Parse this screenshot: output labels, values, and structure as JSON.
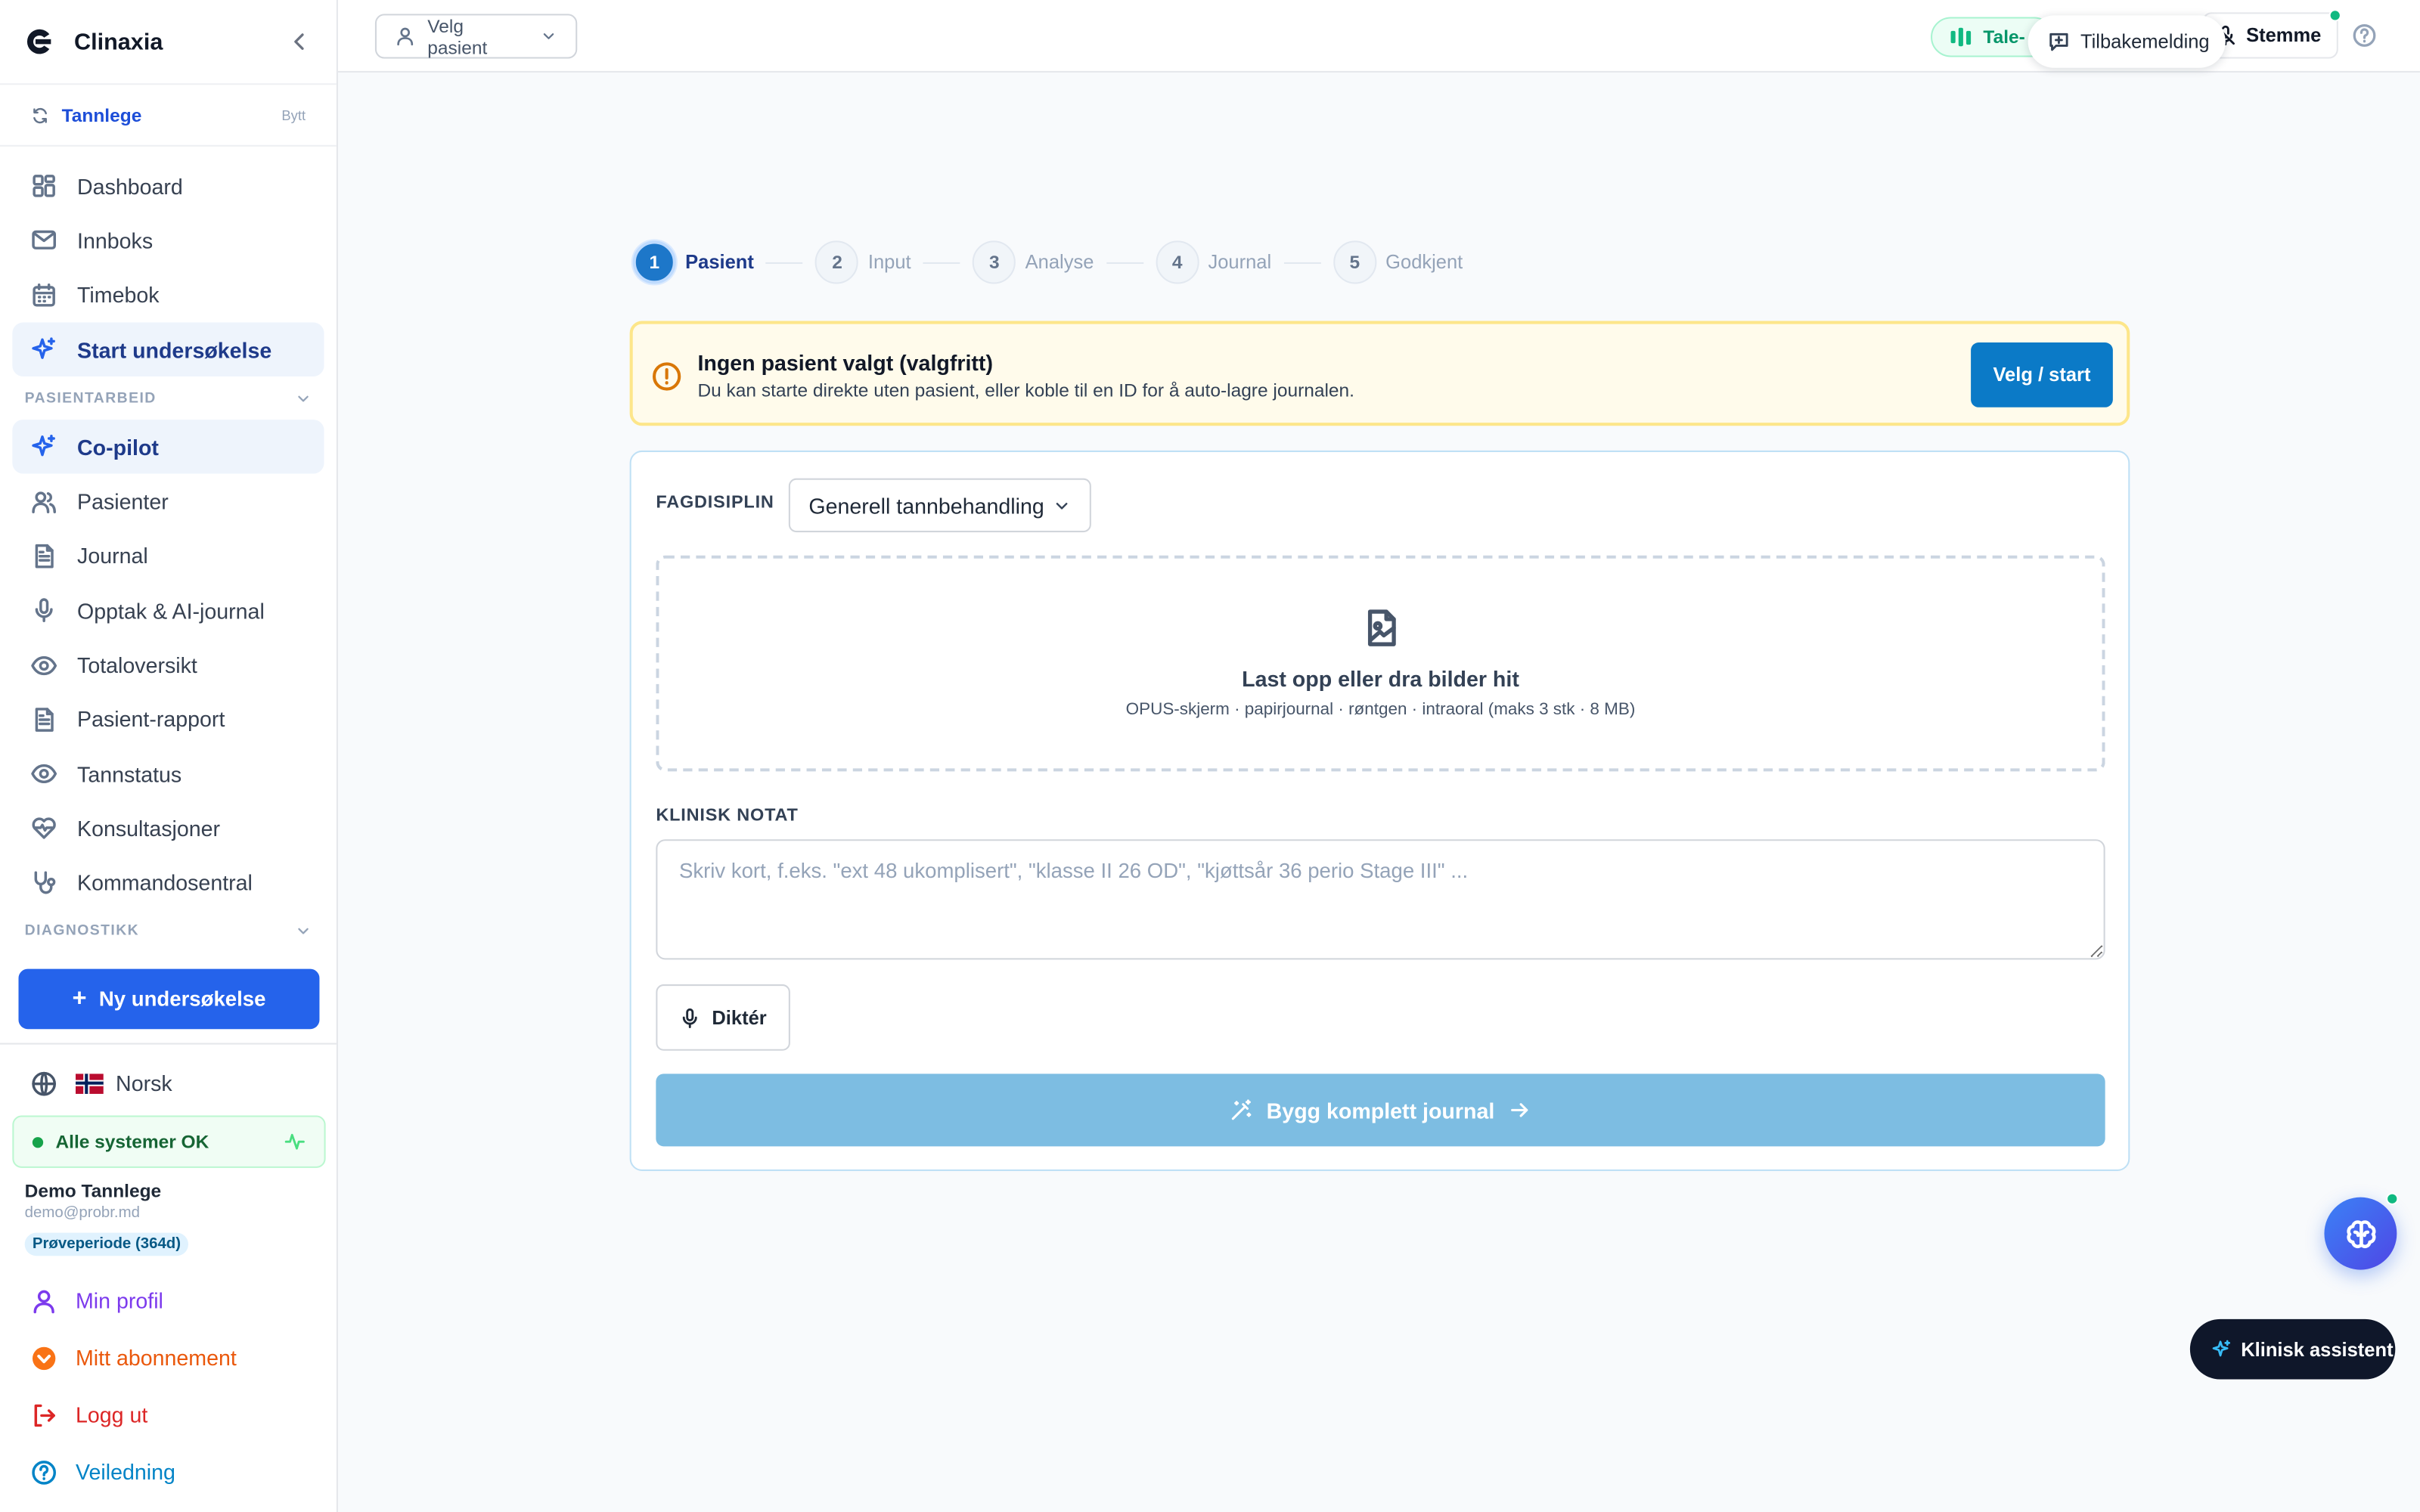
{
  "app": {
    "name": "Clinaxia"
  },
  "role": {
    "label": "Tannlege",
    "switch_label": "Bytt"
  },
  "nav": {
    "primary": [
      {
        "label": "Dashboard",
        "icon": "dashboard-icon"
      },
      {
        "label": "Innboks",
        "icon": "mail-icon"
      },
      {
        "label": "Timebok",
        "icon": "calendar-icon"
      },
      {
        "label": "Start undersøkelse",
        "icon": "sparkle-icon",
        "active": true
      }
    ],
    "section_patient": "PASIENTARBEID",
    "patient": [
      {
        "label": "Co-pilot",
        "icon": "sparkle-icon",
        "active": true
      },
      {
        "label": "Pasienter",
        "icon": "users-icon"
      },
      {
        "label": "Journal",
        "icon": "document-icon"
      },
      {
        "label": "Opptak & AI-journal",
        "icon": "microphone-icon"
      },
      {
        "label": "Totaloversikt",
        "icon": "eye-icon"
      },
      {
        "label": "Pasient-rapport",
        "icon": "document-icon"
      },
      {
        "label": "Tannstatus",
        "icon": "eye-icon"
      },
      {
        "label": "Konsultasjoner",
        "icon": "heart-pulse-icon"
      },
      {
        "label": "Kommandosentral",
        "icon": "stethoscope-icon"
      }
    ],
    "section_diagnostics": "DIAGNOSTIKK"
  },
  "new_exam_label": "Ny undersøkelse",
  "language": {
    "label": "Norsk"
  },
  "system_status": {
    "label": "Alle systemer OK",
    "color": "#16a34a"
  },
  "user": {
    "name": "Demo Tannlege",
    "email": "demo@probr.md",
    "trial": "Prøveperiode (364d)"
  },
  "bottom_links": {
    "profile": "Min profil",
    "subscription": "Mitt abonnement",
    "logout": "Logg ut",
    "guide": "Veiledning"
  },
  "topbar": {
    "patient_select": "Velg pasient",
    "tale_label": "Tale-",
    "feedback_label": "Tilbakemelding",
    "voice_label": "Stemme"
  },
  "steps": [
    {
      "num": "1",
      "label": "Pasient"
    },
    {
      "num": "2",
      "label": "Input"
    },
    {
      "num": "3",
      "label": "Analyse"
    },
    {
      "num": "4",
      "label": "Journal"
    },
    {
      "num": "5",
      "label": "Godkjent"
    }
  ],
  "warning": {
    "title": "Ingen pasient valgt (valgfritt)",
    "text": "Du kan starte direkte uten pasient, eller koble til en ID for å auto-lagre journalen.",
    "button": "Velg / start"
  },
  "form": {
    "discipline_label": "FAGDISIPLIN",
    "discipline_value": "Generell tannbehandling",
    "upload_title": "Last opp eller dra bilder hit",
    "upload_sub": "OPUS-skjerm · papirjournal · røntgen · intraoral (maks 3 stk · 8 MB)",
    "note_label": "KLINISK NOTAT",
    "note_placeholder": "Skriv kort, f.eks. \"ext 48 ukomplisert\", \"klasse II 26 OD\", \"kjøttsår 36 perio Stage III\" ...",
    "note_value": "",
    "dictate_label": "Diktér",
    "build_label": "Bygg komplett journal"
  },
  "assistant_label": "Klinisk assistent",
  "colors": {
    "primary": "#2563eb",
    "accent": "#0b7ac7",
    "warning_bg": "#fffbeb",
    "warning_border": "#fde68a",
    "build_disabled": "#7dbde2"
  }
}
